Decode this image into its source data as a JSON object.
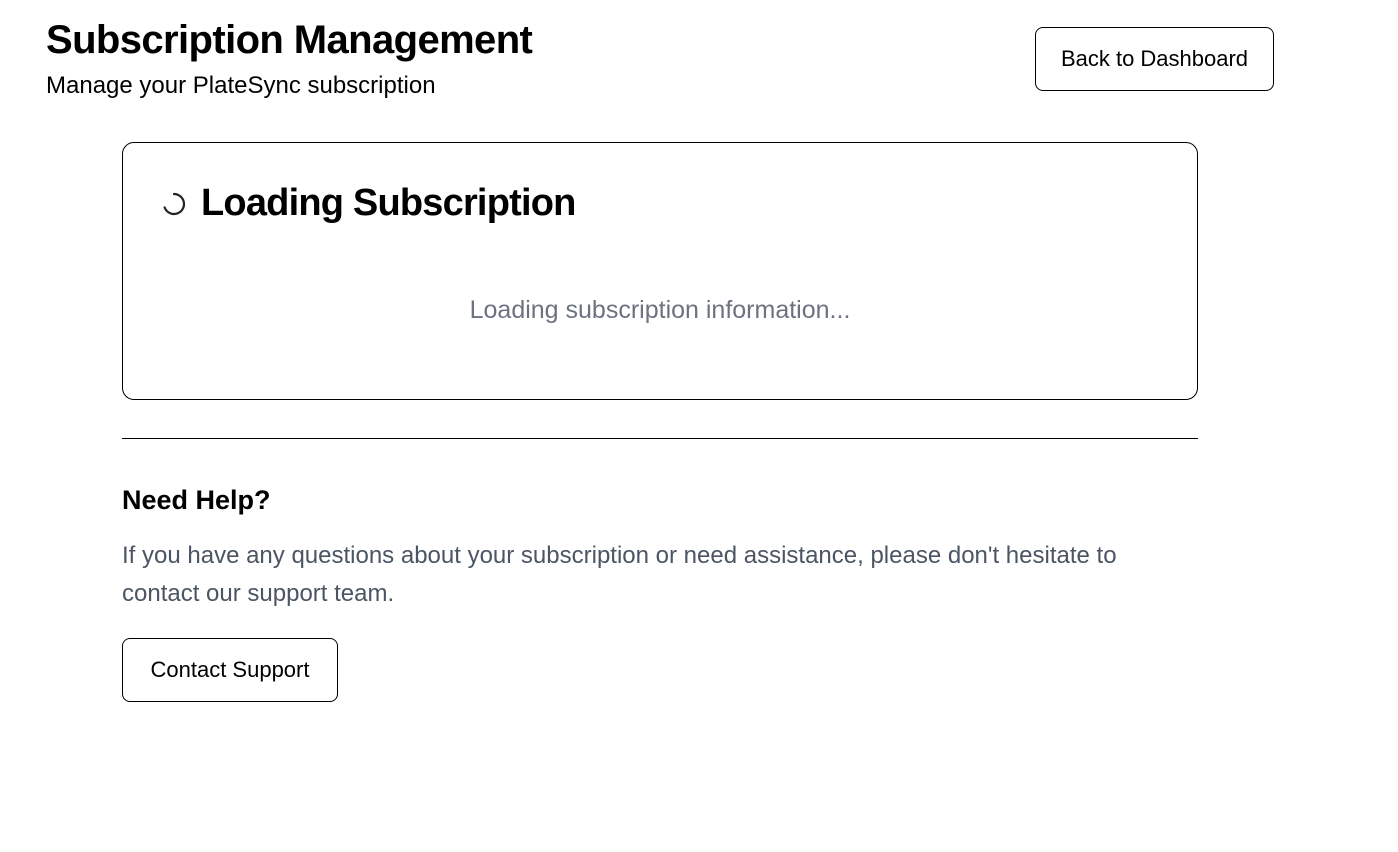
{
  "header": {
    "title": "Subscription Management",
    "subtitle": "Manage your PlateSync subscription",
    "back_button_label": "Back to Dashboard"
  },
  "loading_card": {
    "icon": "spinner-icon",
    "title": "Loading Subscription",
    "message": "Loading subscription information..."
  },
  "help": {
    "title": "Need Help?",
    "text": "If you have any questions about your subscription or need assistance, please don't hesitate to contact our support team.",
    "contact_button_label": "Contact Support"
  },
  "colors": {
    "text": "#000000",
    "muted_text": "#6b7280",
    "body_text": "#4b5563",
    "border": "#000000",
    "background": "#ffffff"
  }
}
